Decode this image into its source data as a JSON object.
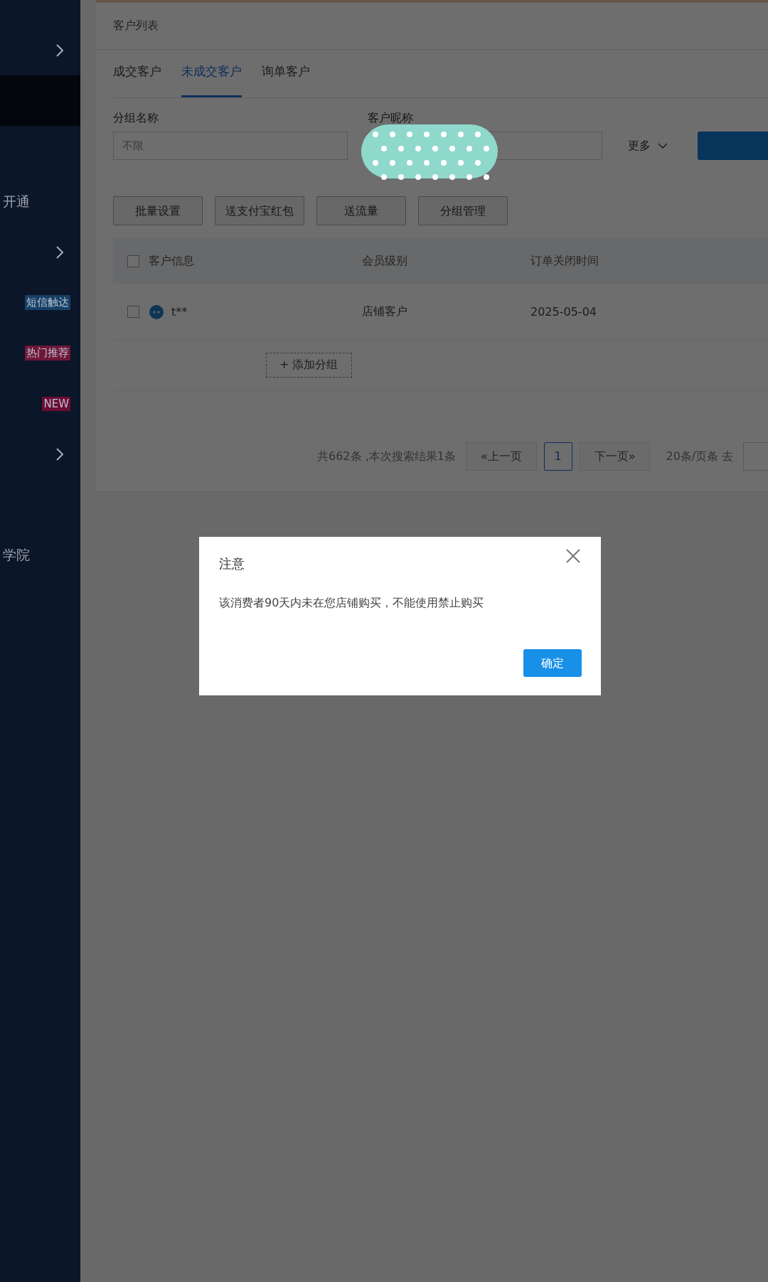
{
  "sidebar": {
    "items": [
      {
        "selected": false,
        "chevron": true
      },
      {
        "selected": true
      },
      {
        "selected": false
      },
      {
        "selected": false,
        "label": "开通"
      },
      {
        "selected": false,
        "chevron": true
      },
      {
        "selected": false,
        "badge": {
          "text": "短信触达",
          "color": "#173f66"
        }
      },
      {
        "selected": false,
        "badge": {
          "text": "热门推荐",
          "color": "#6e1636"
        }
      },
      {
        "selected": false,
        "badge": {
          "text": "NEW",
          "color": "#6c0c36"
        }
      },
      {
        "selected": false,
        "chevron": true
      },
      {
        "selected": false
      },
      {
        "selected": false,
        "label": "学院"
      }
    ]
  },
  "panel": {
    "title": "客户列表",
    "tabs": [
      {
        "label": "成交客户",
        "selected": false
      },
      {
        "label": "未成交客户",
        "selected": true
      },
      {
        "label": "询单客户",
        "selected": false
      }
    ],
    "filters": [
      {
        "label": "分组名称",
        "placeholder": "不限"
      },
      {
        "label": "客户昵称"
      }
    ],
    "more": "更多",
    "actions": [
      "批量设置",
      "送支付宝红包",
      "送流量",
      "分组管理"
    ],
    "table": {
      "select_all": {
        "checked": false
      },
      "columns": [
        "客户信息",
        "会员级别",
        "订单关闭时间"
      ],
      "rows": [
        {
          "checked": false,
          "name": "t**",
          "level": "店铺客户",
          "closed": "2025-05-04"
        }
      ]
    },
    "add_group": "+ 添加分组",
    "pagination": {
      "summary": "共662条 ,本次搜索结果1条",
      "prev": "«上一页",
      "pages": [
        {
          "label": "1",
          "selected": true
        }
      ],
      "next": "下一页»",
      "per_page": "20条/页条 去"
    }
  },
  "dialog": {
    "title": "注意",
    "message": "该消费者90天内未在您店铺购买，不能使用禁止购买",
    "confirm": "确定"
  }
}
